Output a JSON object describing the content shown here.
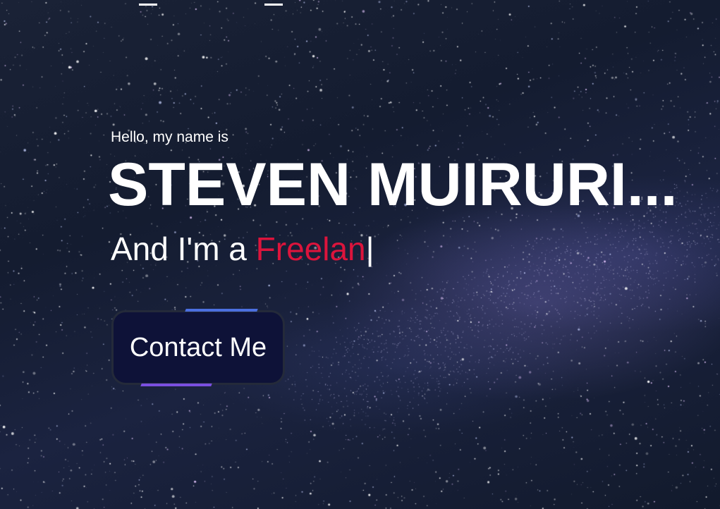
{
  "hero": {
    "intro": "Hello, my name is",
    "name": "STEVEN MUIRURI...",
    "tagline_prefix": "And I'm a ",
    "typed_text": "Freelan",
    "cursor": "|"
  },
  "cta": {
    "label": "Contact Me"
  },
  "colors": {
    "accent": "#dc143c",
    "button_bg": "#0e1238",
    "button_accent_top": "#4b6fe0",
    "button_accent_bottom": "#7a4fe0"
  }
}
